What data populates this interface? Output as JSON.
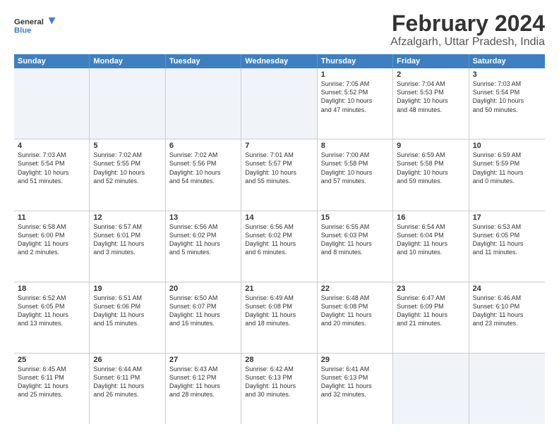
{
  "logo": {
    "line1": "General",
    "line2": "Blue"
  },
  "title": "February 2024",
  "subtitle": "Afzalgarh, Uttar Pradesh, India",
  "days_header": [
    "Sunday",
    "Monday",
    "Tuesday",
    "Wednesday",
    "Thursday",
    "Friday",
    "Saturday"
  ],
  "weeks": [
    [
      {
        "day": "",
        "lines": [],
        "shaded": true
      },
      {
        "day": "",
        "lines": [],
        "shaded": true
      },
      {
        "day": "",
        "lines": [],
        "shaded": true
      },
      {
        "day": "",
        "lines": [],
        "shaded": true
      },
      {
        "day": "1",
        "lines": [
          "Sunrise: 7:05 AM",
          "Sunset: 5:52 PM",
          "Daylight: 10 hours",
          "and 47 minutes."
        ]
      },
      {
        "day": "2",
        "lines": [
          "Sunrise: 7:04 AM",
          "Sunset: 5:53 PM",
          "Daylight: 10 hours",
          "and 48 minutes."
        ]
      },
      {
        "day": "3",
        "lines": [
          "Sunrise: 7:03 AM",
          "Sunset: 5:54 PM",
          "Daylight: 10 hours",
          "and 50 minutes."
        ]
      }
    ],
    [
      {
        "day": "4",
        "lines": [
          "Sunrise: 7:03 AM",
          "Sunset: 5:54 PM",
          "Daylight: 10 hours",
          "and 51 minutes."
        ]
      },
      {
        "day": "5",
        "lines": [
          "Sunrise: 7:02 AM",
          "Sunset: 5:55 PM",
          "Daylight: 10 hours",
          "and 52 minutes."
        ]
      },
      {
        "day": "6",
        "lines": [
          "Sunrise: 7:02 AM",
          "Sunset: 5:56 PM",
          "Daylight: 10 hours",
          "and 54 minutes."
        ]
      },
      {
        "day": "7",
        "lines": [
          "Sunrise: 7:01 AM",
          "Sunset: 5:57 PM",
          "Daylight: 10 hours",
          "and 55 minutes."
        ]
      },
      {
        "day": "8",
        "lines": [
          "Sunrise: 7:00 AM",
          "Sunset: 5:58 PM",
          "Daylight: 10 hours",
          "and 57 minutes."
        ]
      },
      {
        "day": "9",
        "lines": [
          "Sunrise: 6:59 AM",
          "Sunset: 5:58 PM",
          "Daylight: 10 hours",
          "and 59 minutes."
        ]
      },
      {
        "day": "10",
        "lines": [
          "Sunrise: 6:59 AM",
          "Sunset: 5:59 PM",
          "Daylight: 11 hours",
          "and 0 minutes."
        ]
      }
    ],
    [
      {
        "day": "11",
        "lines": [
          "Sunrise: 6:58 AM",
          "Sunset: 6:00 PM",
          "Daylight: 11 hours",
          "and 2 minutes."
        ]
      },
      {
        "day": "12",
        "lines": [
          "Sunrise: 6:57 AM",
          "Sunset: 6:01 PM",
          "Daylight: 11 hours",
          "and 3 minutes."
        ]
      },
      {
        "day": "13",
        "lines": [
          "Sunrise: 6:56 AM",
          "Sunset: 6:02 PM",
          "Daylight: 11 hours",
          "and 5 minutes."
        ]
      },
      {
        "day": "14",
        "lines": [
          "Sunrise: 6:56 AM",
          "Sunset: 6:02 PM",
          "Daylight: 11 hours",
          "and 6 minutes."
        ]
      },
      {
        "day": "15",
        "lines": [
          "Sunrise: 6:55 AM",
          "Sunset: 6:03 PM",
          "Daylight: 11 hours",
          "and 8 minutes."
        ]
      },
      {
        "day": "16",
        "lines": [
          "Sunrise: 6:54 AM",
          "Sunset: 6:04 PM",
          "Daylight: 11 hours",
          "and 10 minutes."
        ]
      },
      {
        "day": "17",
        "lines": [
          "Sunrise: 6:53 AM",
          "Sunset: 6:05 PM",
          "Daylight: 11 hours",
          "and 11 minutes."
        ]
      }
    ],
    [
      {
        "day": "18",
        "lines": [
          "Sunrise: 6:52 AM",
          "Sunset: 6:05 PM",
          "Daylight: 11 hours",
          "and 13 minutes."
        ]
      },
      {
        "day": "19",
        "lines": [
          "Sunrise: 6:51 AM",
          "Sunset: 6:06 PM",
          "Daylight: 11 hours",
          "and 15 minutes."
        ]
      },
      {
        "day": "20",
        "lines": [
          "Sunrise: 6:50 AM",
          "Sunset: 6:07 PM",
          "Daylight: 11 hours",
          "and 16 minutes."
        ]
      },
      {
        "day": "21",
        "lines": [
          "Sunrise: 6:49 AM",
          "Sunset: 6:08 PM",
          "Daylight: 11 hours",
          "and 18 minutes."
        ]
      },
      {
        "day": "22",
        "lines": [
          "Sunrise: 6:48 AM",
          "Sunset: 6:08 PM",
          "Daylight: 11 hours",
          "and 20 minutes."
        ]
      },
      {
        "day": "23",
        "lines": [
          "Sunrise: 6:47 AM",
          "Sunset: 6:09 PM",
          "Daylight: 11 hours",
          "and 21 minutes."
        ]
      },
      {
        "day": "24",
        "lines": [
          "Sunrise: 6:46 AM",
          "Sunset: 6:10 PM",
          "Daylight: 11 hours",
          "and 23 minutes."
        ]
      }
    ],
    [
      {
        "day": "25",
        "lines": [
          "Sunrise: 6:45 AM",
          "Sunset: 6:11 PM",
          "Daylight: 11 hours",
          "and 25 minutes."
        ]
      },
      {
        "day": "26",
        "lines": [
          "Sunrise: 6:44 AM",
          "Sunset: 6:11 PM",
          "Daylight: 11 hours",
          "and 26 minutes."
        ]
      },
      {
        "day": "27",
        "lines": [
          "Sunrise: 6:43 AM",
          "Sunset: 6:12 PM",
          "Daylight: 11 hours",
          "and 28 minutes."
        ]
      },
      {
        "day": "28",
        "lines": [
          "Sunrise: 6:42 AM",
          "Sunset: 6:13 PM",
          "Daylight: 11 hours",
          "and 30 minutes."
        ]
      },
      {
        "day": "29",
        "lines": [
          "Sunrise: 6:41 AM",
          "Sunset: 6:13 PM",
          "Daylight: 11 hours",
          "and 32 minutes."
        ]
      },
      {
        "day": "",
        "lines": [],
        "shaded": true
      },
      {
        "day": "",
        "lines": [],
        "shaded": true
      }
    ]
  ]
}
